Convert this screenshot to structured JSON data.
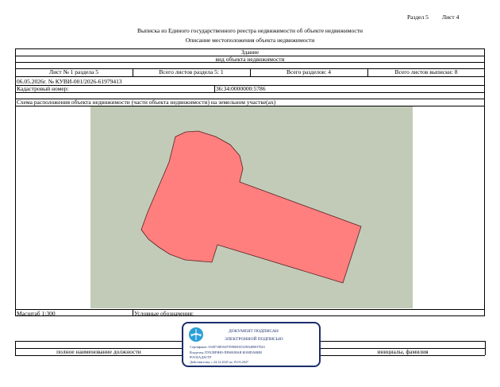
{
  "header": {
    "section": "Раздел 5",
    "sheet": "Лист 4",
    "title": "Выписка из Единого государственного реестра недвижимости об объекте недвижимости",
    "subtitle": "Описание местоположения объекта недвижимости"
  },
  "object": {
    "type": "Здание",
    "type_label": "вид объекта недвижимости"
  },
  "sheets": {
    "sheet_of_section": "Лист № 1 раздела 5",
    "sheets_in_section": "Всего листов раздела 5: 1",
    "sections_total": "Всего разделов: 4",
    "sheets_total": "Всего листов выписки: 8"
  },
  "doc": {
    "date_number": "06.05.2026г. № КУВИ-001/2026-61979413",
    "cadastral_label": "Кадастровый номер:",
    "cadastral_value": "36:34:0000000:5786"
  },
  "scheme": {
    "label": "Схема расположения объекта недвижимости (части объекта недвижимости) на земельном участке(ах)",
    "background_color": "#c2cbb8",
    "shape_color": "#ff7f7f"
  },
  "footer": {
    "scale": "Масштаб 1:300",
    "legend": "Условные обозначения:",
    "position_label": "полное наименование должности",
    "name_label": "инициалы, фамилия"
  },
  "stamp": {
    "line1": "ДОКУМЕНТ ПОДПИСАН",
    "line2": "ЭЛЕКТРОННОЙ ПОДПИСЬЮ",
    "certificate": "Сертификат: 0349718818479590693552903400037843",
    "owner": "Владелец: ПУБЛИЧНО-ПРАВОВАЯ КОМПАНИЯ",
    "owner2": "РОСКАДАСТР",
    "valid": "Действителен: с 24.12.2025 по 19.03.2027",
    "border_color": "#1b2e6b",
    "icon": "signature-emblem-icon"
  }
}
